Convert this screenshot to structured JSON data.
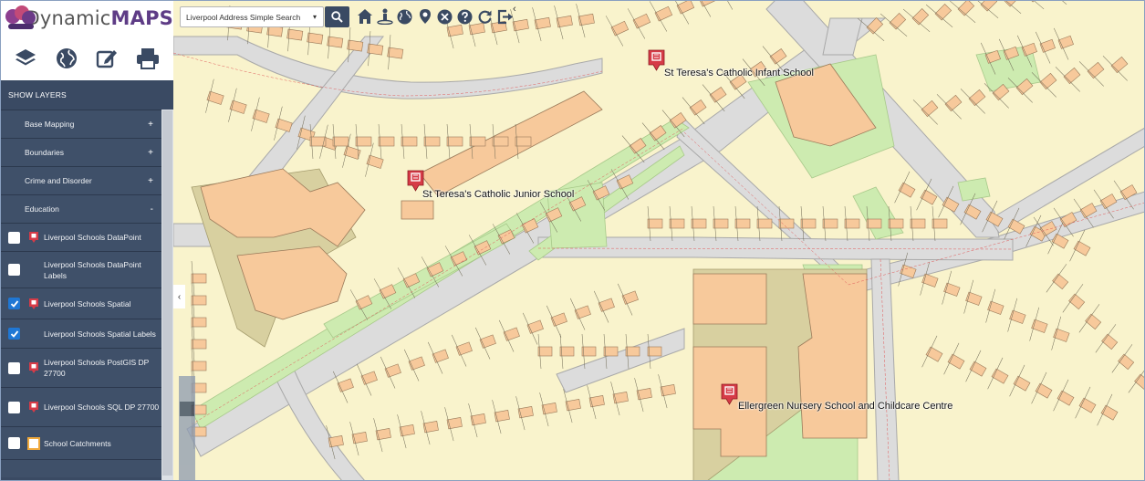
{
  "brand": {
    "prefix": "Dynamic",
    "suffix": "MAPS"
  },
  "toolbar": {
    "icons": [
      "layers-icon",
      "globe-icon",
      "edit-icon",
      "print-icon"
    ]
  },
  "panel": {
    "title": "SHOW LAYERS",
    "categories": [
      {
        "label": "Base Mapping",
        "sign": "+"
      },
      {
        "label": "Boundaries",
        "sign": "+"
      },
      {
        "label": "Crime and Disorder",
        "sign": "+"
      },
      {
        "label": "Education",
        "sign": "-"
      }
    ],
    "layers": [
      {
        "label": "Liverpool Schools DataPoint",
        "checked": false,
        "icon": "school-pin-icon"
      },
      {
        "label": "Liverpool Schools DataPoint Labels",
        "checked": false,
        "icon": ""
      },
      {
        "label": "Liverpool Schools Spatial",
        "checked": true,
        "icon": "school-pin-icon"
      },
      {
        "label": "Liverpool Schools Spatial Labels",
        "checked": true,
        "icon": ""
      },
      {
        "label": "Liverpool Schools PostGIS DP 27700",
        "checked": false,
        "icon": "school-pin-icon"
      },
      {
        "label": "Liverpool Schools SQL DP 27700",
        "checked": false,
        "icon": "school-pin-icon"
      },
      {
        "label": "School Catchments",
        "checked": false,
        "icon": "catchment-square-icon"
      }
    ]
  },
  "search": {
    "mode": "Liverpool Address Simple Search"
  },
  "map_tools": [
    "home-icon",
    "locate-person-icon",
    "globe-icon",
    "marker-icon",
    "close-circle-icon",
    "help-icon",
    "refresh-icon",
    "logout-icon"
  ],
  "schools": [
    {
      "name": "St Teresa's Catholic Infant School"
    },
    {
      "name": "St Teresa's Catholic Junior School"
    },
    {
      "name": "Ellergreen Nursery School and Childcare Centre"
    }
  ],
  "colors": {
    "panel": "#3a4a63",
    "accent": "#1f77d4",
    "building": "#f7c99b",
    "green": "#cdebb0",
    "land": "#f9f3cc",
    "road": "#dcdcdc",
    "pin": "#d63b47"
  }
}
